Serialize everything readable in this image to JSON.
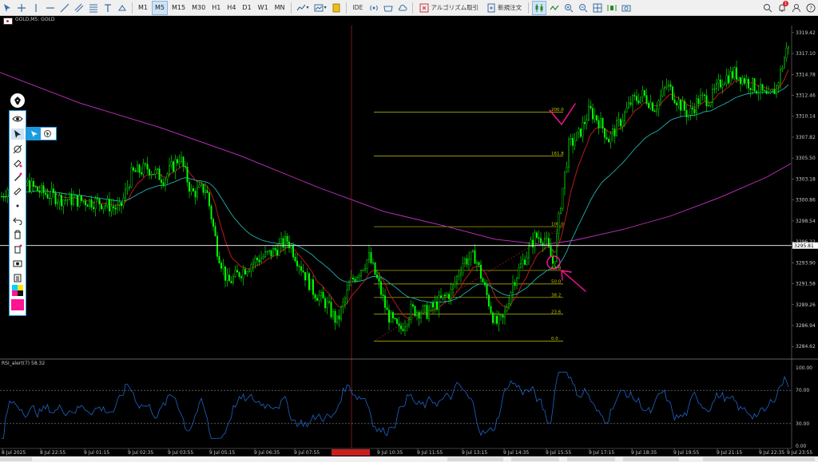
{
  "toolbar": {
    "timeframes": [
      "M1",
      "M5",
      "M15",
      "M30",
      "H1",
      "H4",
      "D1",
      "W1",
      "MN"
    ],
    "active_timeframe": "M5",
    "ide_label": "IDE",
    "algo_label": "アルゴリズム取引",
    "new_order_label": "新規注文",
    "notification_count": "1"
  },
  "chart": {
    "symbol_title": "GOLD,M5:  GOLD",
    "rsi_title": "RSI_alert(7) 58.32",
    "current_price": "3295.81",
    "price_labels": [
      "3319.42",
      "3317.10",
      "3314.78",
      "3312.46",
      "3310.14",
      "3307.82",
      "3305.50",
      "3303.18",
      "3300.86",
      "3298.54",
      "3296.22",
      "3293.90",
      "3291.58",
      "3289.26",
      "3286.94",
      "3284.62"
    ],
    "rsi_labels": [
      "100.00",
      "70.00",
      "30.00",
      "0.00"
    ],
    "time_labels": [
      "8 Jul 2025",
      "8 Jul 22:55",
      "9 Jul 01:15",
      "9 Jul 02:35",
      "9 Jul 03:55",
      "9 Jul 05:15",
      "9 Jul 06:35",
      "9 Jul 07:55",
      "9 Jul 10:35",
      "9 Jul 11:55",
      "9 Jul 13:15",
      "9 Jul 14:35",
      "9 Jul 15:55",
      "9 Jul 17:15",
      "9 Jul 18:35",
      "9 Jul 19:55",
      "9 Jul 21:15",
      "9 Jul 22:35",
      "9 Jul 23:55"
    ],
    "fib_levels": [
      {
        "label": "200.0",
        "value": 200
      },
      {
        "label": "161.8",
        "value": 161.8
      },
      {
        "label": "100.0",
        "value": 100
      },
      {
        "label": "61.8",
        "value": 61.8
      },
      {
        "label": "50.0",
        "value": 50
      },
      {
        "label": "38.2",
        "value": 38.2
      },
      {
        "label": "23.6",
        "value": 23.6
      },
      {
        "label": "0.0",
        "value": 0
      }
    ]
  },
  "colors": {
    "candle": "#00ff00",
    "ma_fast": "#c81e1e",
    "ma_mid": "#1fb0b0",
    "ma_slow": "#c832c8",
    "fib": "#c8c800",
    "rsi": "#1e64c8",
    "annotation": "#ff1493"
  }
}
